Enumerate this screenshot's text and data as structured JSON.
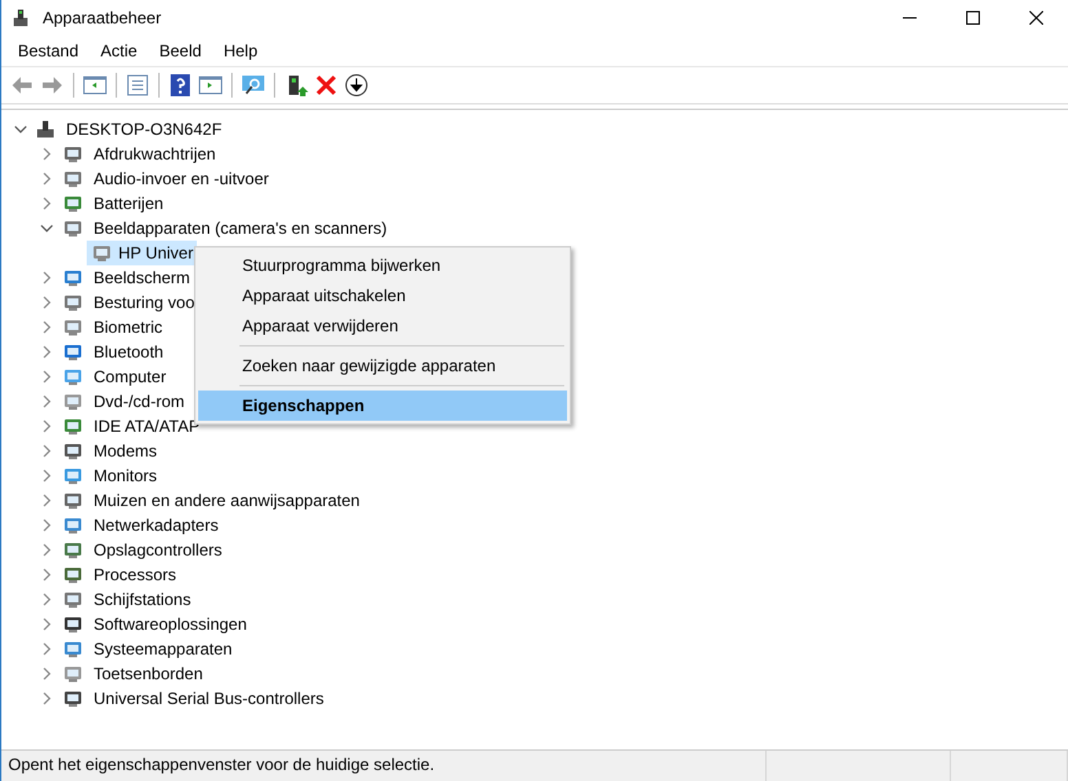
{
  "window": {
    "title": "Apparaatbeheer"
  },
  "menu_bar": [
    "Bestand",
    "Actie",
    "Beeld",
    "Help"
  ],
  "tree": {
    "label": "DESKTOP-O3N642F",
    "expanded": true,
    "children": [
      {
        "label": "Afdrukwachtrijen",
        "expanded": false,
        "selected": false
      },
      {
        "label": "Audio-invoer en -uitvoer",
        "expanded": false,
        "selected": false
      },
      {
        "label": "Batterijen",
        "expanded": false,
        "selected": false
      },
      {
        "label": "Beeldapparaten (camera's en scanners)",
        "expanded": true,
        "selected": false,
        "children": [
          {
            "label": "HP Univer",
            "selected": true
          }
        ]
      },
      {
        "label": "Beeldscherm",
        "expanded": false,
        "selected": false
      },
      {
        "label": "Besturing voo",
        "expanded": false,
        "selected": false
      },
      {
        "label": "Biometric",
        "expanded": false,
        "selected": false
      },
      {
        "label": "Bluetooth",
        "expanded": false,
        "selected": false
      },
      {
        "label": "Computer",
        "expanded": false,
        "selected": false
      },
      {
        "label": "Dvd-/cd-rom",
        "expanded": false,
        "selected": false
      },
      {
        "label": "IDE ATA/ATAP",
        "expanded": false,
        "selected": false
      },
      {
        "label": "Modems",
        "expanded": false,
        "selected": false
      },
      {
        "label": "Monitors",
        "expanded": false,
        "selected": false
      },
      {
        "label": "Muizen en andere aanwijsapparaten",
        "expanded": false,
        "selected": false
      },
      {
        "label": "Netwerkadapters",
        "expanded": false,
        "selected": false
      },
      {
        "label": "Opslagcontrollers",
        "expanded": false,
        "selected": false
      },
      {
        "label": "Processors",
        "expanded": false,
        "selected": false
      },
      {
        "label": "Schijfstations",
        "expanded": false,
        "selected": false
      },
      {
        "label": "Softwareoplossingen",
        "expanded": false,
        "selected": false
      },
      {
        "label": "Systeemapparaten",
        "expanded": false,
        "selected": false
      },
      {
        "label": "Toetsenborden",
        "expanded": false,
        "selected": false
      },
      {
        "label": "Universal Serial Bus-controllers",
        "expanded": false,
        "selected": false
      }
    ]
  },
  "context_menu": [
    {
      "kind": "item",
      "label": "Stuurprogramma bijwerken",
      "selected": false,
      "bold": false
    },
    {
      "kind": "item",
      "label": "Apparaat uitschakelen",
      "selected": false,
      "bold": false
    },
    {
      "kind": "item",
      "label": "Apparaat verwijderen",
      "selected": false,
      "bold": false
    },
    {
      "kind": "separator"
    },
    {
      "kind": "item",
      "label": "Zoeken naar gewijzigde apparaten",
      "selected": false,
      "bold": false
    },
    {
      "kind": "separator"
    },
    {
      "kind": "item",
      "label": "Eigenschappen",
      "selected": true,
      "bold": true
    }
  ],
  "status_bar": "Opent het eigenschappenvenster voor de huidige selectie."
}
